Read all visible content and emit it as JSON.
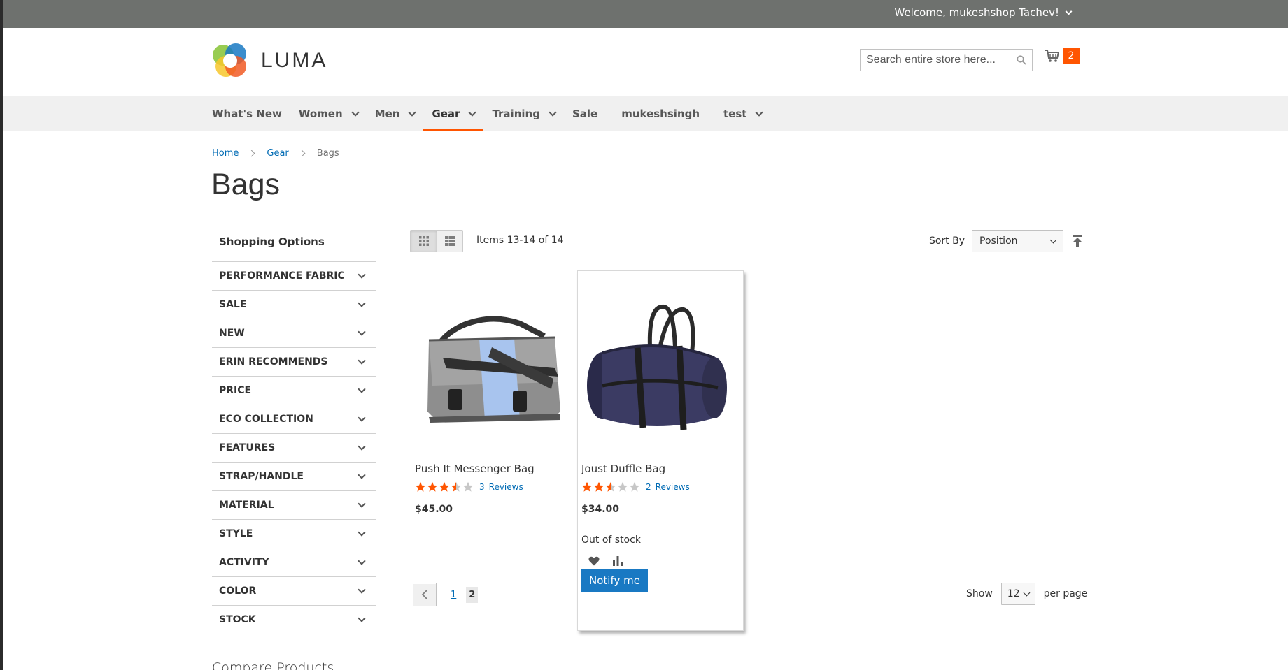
{
  "header": {
    "welcome": "Welcome, mukeshshop Tachev!",
    "logo_text": "LUMA",
    "search_placeholder": "Search entire store here...",
    "cart_count": "2"
  },
  "nav": {
    "items": [
      {
        "label": "What's New",
        "dropdown": false
      },
      {
        "label": "Women",
        "dropdown": true
      },
      {
        "label": "Men",
        "dropdown": true
      },
      {
        "label": "Gear",
        "dropdown": true,
        "active": true
      },
      {
        "label": "Training",
        "dropdown": true
      },
      {
        "label": "Sale",
        "dropdown": false
      },
      {
        "label": "mukeshsingh",
        "dropdown": false
      },
      {
        "label": "test",
        "dropdown": true
      }
    ]
  },
  "breadcrumb": {
    "home": "Home",
    "gear": "Gear",
    "current": "Bags"
  },
  "page_title": "Bags",
  "sidebar": {
    "title": "Shopping Options",
    "filters": [
      "PERFORMANCE FABRIC",
      "SALE",
      "NEW",
      "ERIN RECOMMENDS",
      "PRICE",
      "ECO COLLECTION",
      "FEATURES",
      "STRAP/HANDLE",
      "MATERIAL",
      "STYLE",
      "ACTIVITY",
      "COLOR",
      "STOCK"
    ],
    "compare_title": "Compare Products"
  },
  "toolbar": {
    "amount": "Items 13-14 of 14",
    "sort_label": "Sort By",
    "sort_value": "Position"
  },
  "products": [
    {
      "name": "Push It Messenger Bag",
      "rating": 3.5,
      "reviews_count": "3",
      "reviews_label": "Reviews",
      "price": "$45.00"
    },
    {
      "name": "Joust Duffle Bag",
      "rating": 2.5,
      "reviews_count": "2",
      "reviews_label": "Reviews",
      "price": "$34.00",
      "stock": "Out of stock",
      "notify_label": "Notify me"
    }
  ],
  "pager": {
    "pages": [
      "1",
      "2"
    ],
    "current": "2"
  },
  "limiter": {
    "show_label": "Show",
    "value": "12",
    "per_page_label": "per page"
  },
  "colors": {
    "accent_orange": "#ff5501",
    "link_blue": "#006bb4",
    "button_blue": "#1979c3",
    "top_bar": "#6e716e",
    "nav_bg": "#f0f0f0"
  }
}
